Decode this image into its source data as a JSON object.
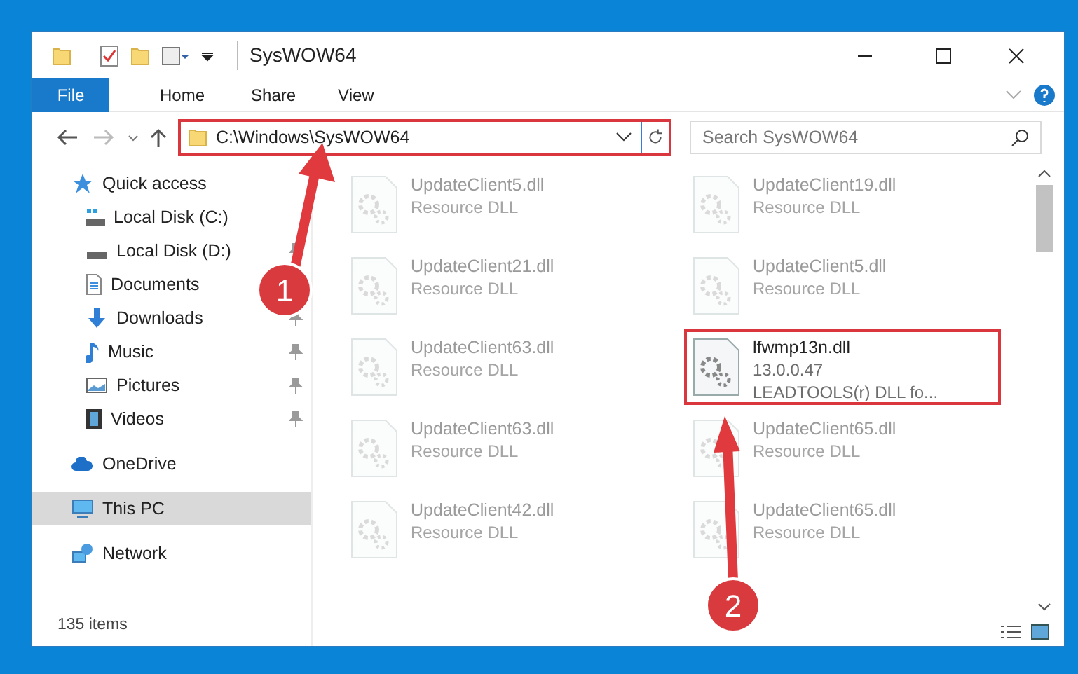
{
  "window": {
    "title": "SysWOW64"
  },
  "ribbon": {
    "tabs": [
      {
        "label": "File",
        "selected": true
      },
      {
        "label": "Home",
        "selected": false
      },
      {
        "label": "Share",
        "selected": false
      },
      {
        "label": "View",
        "selected": false
      }
    ]
  },
  "address_bar": {
    "path": "C:\\Windows\\SysWOW64",
    "highlighted": true
  },
  "search": {
    "placeholder": "Search SysWOW64"
  },
  "sidebar": {
    "items": [
      {
        "label": "Quick access",
        "selected": false,
        "children": [
          {
            "label": "Local Disk (C:)",
            "pinned": false,
            "selected": false
          },
          {
            "label": "Local Disk (D:)",
            "pinned": true,
            "selected": false
          },
          {
            "label": "Documents",
            "selected": false
          },
          {
            "label": "Downloads",
            "pinned": true,
            "selected": false
          },
          {
            "label": "Music",
            "pinned": true,
            "selected": false
          },
          {
            "label": "Pictures",
            "pinned": true,
            "selected": false
          },
          {
            "label": "Videos",
            "pinned": true,
            "selected": false
          }
        ]
      },
      {
        "label": "OneDrive",
        "selected": false
      },
      {
        "label": "This PC",
        "selected": true
      },
      {
        "label": "Network",
        "selected": false
      }
    ]
  },
  "files": [
    {
      "name": "UpdateClient5.dll",
      "details": [
        "Resource DLL"
      ],
      "highlighted": false
    },
    {
      "name": "UpdateClient19.dll",
      "details": [
        "Resource DLL"
      ],
      "highlighted": false
    },
    {
      "name": "UpdateClient21.dll",
      "details": [
        "Resource DLL"
      ],
      "highlighted": false
    },
    {
      "name": "UpdateClient5.dll",
      "details": [
        "Resource DLL"
      ],
      "highlighted": false
    },
    {
      "name": "UpdateClient63.dll",
      "details": [
        "Resource DLL"
      ],
      "highlighted": false
    },
    {
      "name": "lfwmp13n.dll",
      "details": [
        "13.0.0.47",
        "LEADTOOLS(r) DLL fo..."
      ],
      "highlighted": true
    },
    {
      "name": "UpdateClient63.dll",
      "details": [
        "Resource DLL"
      ],
      "highlighted": false
    },
    {
      "name": "UpdateClient65.dll",
      "details": [
        "Resource DLL"
      ],
      "highlighted": false
    },
    {
      "name": "UpdateClient42.dll",
      "details": [
        "Resource DLL"
      ],
      "highlighted": false
    },
    {
      "name": "UpdateClient65.dll",
      "details": [
        "Resource DLL"
      ],
      "highlighted": false
    }
  ],
  "status_bar": {
    "count": "135 items"
  },
  "callouts": [
    {
      "number": "1"
    },
    {
      "number": "2"
    }
  ]
}
